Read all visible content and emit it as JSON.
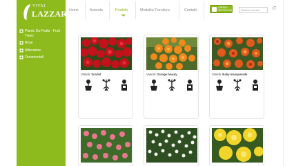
{
  "brand": {
    "line1": "VIVAI",
    "line2": "LAZZARO"
  },
  "sidebar": {
    "items": [
      {
        "label": "Piante Da Frutto - Fruit Trees",
        "icon": "fruit-tree-icon"
      },
      {
        "label": "Rose",
        "icon": "rose-icon"
      },
      {
        "label": "Alberature",
        "icon": "tree-icon"
      },
      {
        "label": "Ornamentali",
        "icon": "ornamental-plant-icon"
      }
    ]
  },
  "nav": {
    "items": [
      {
        "label": "Home"
      },
      {
        "label": "Azienda"
      },
      {
        "label": "Prodotti"
      },
      {
        "label": "Modalita' Fornitura"
      },
      {
        "label": "Contatti"
      }
    ],
    "badge_text": "AZIENDA CERTIFICATA",
    "search_placeholder": "Ricerca nel sito",
    "lang": "IT"
  },
  "products": [
    {
      "variety_prefix": "Varietà:",
      "variety": "Scarlet",
      "image": "red-flowers-photo"
    },
    {
      "variety_prefix": "Varietà:",
      "variety": "Orange beauty",
      "image": "orange-flowers-photo"
    },
    {
      "variety_prefix": "Varietà:",
      "variety": "Baby masquerade",
      "image": "orange-red-flowers-photo"
    }
  ],
  "products_row2": [
    {
      "image": "pink-flowers-photo"
    },
    {
      "image": "white-flowers-photo"
    },
    {
      "image": "yellow-flowers-photo"
    }
  ],
  "colors": {
    "accent": "#8dbb1d",
    "nav_text": "#8a8a8a"
  }
}
